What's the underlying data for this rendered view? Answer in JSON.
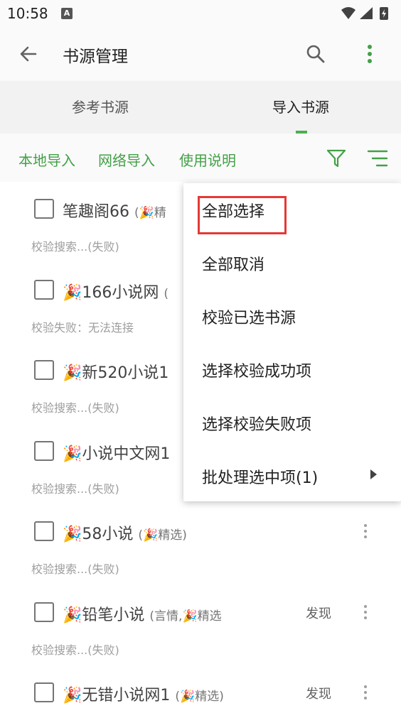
{
  "status_bar": {
    "time": "10:58",
    "notif_letter": "A"
  },
  "app_bar": {
    "title": "书源管理"
  },
  "tabs": [
    {
      "label": "参考书源"
    },
    {
      "label": "导入书源"
    }
  ],
  "actions": {
    "local_import": "本地导入",
    "network_import": "网络导入",
    "help": "使用说明"
  },
  "sources": [
    {
      "name": "笔趣阁66",
      "group": "(🎉精",
      "status": "校验搜索...(失败)",
      "discover": ""
    },
    {
      "name": "🎉166小说网",
      "group": "(",
      "status": "校验失败：无法连接",
      "discover": ""
    },
    {
      "name": "🎉新520小说1",
      "group": "",
      "status": "校验搜索...(失败)",
      "discover": ""
    },
    {
      "name": "🎉小说中文网1",
      "group": "",
      "status": "校验搜索...(失败)",
      "discover": ""
    },
    {
      "name": "🎉58小说",
      "group": "(🎉精选)",
      "status": "校验搜索...(失败)",
      "discover": ""
    },
    {
      "name": "🎉铅笔小说",
      "group": "(言情,🎉精选",
      "status": "校验搜索...(失败)",
      "discover": "发现"
    },
    {
      "name": "🎉无错小说网1",
      "group": "(🎉精选)",
      "status": "",
      "discover": "发现"
    }
  ],
  "menu": {
    "items": [
      {
        "label": "全部选择"
      },
      {
        "label": "全部取消"
      },
      {
        "label": "校验已选书源"
      },
      {
        "label": "选择校验成功项"
      },
      {
        "label": "选择校验失败项"
      },
      {
        "label": "批处理选中项(1)"
      }
    ]
  },
  "colors": {
    "accent": "#43a047",
    "highlight": "#e53935"
  }
}
